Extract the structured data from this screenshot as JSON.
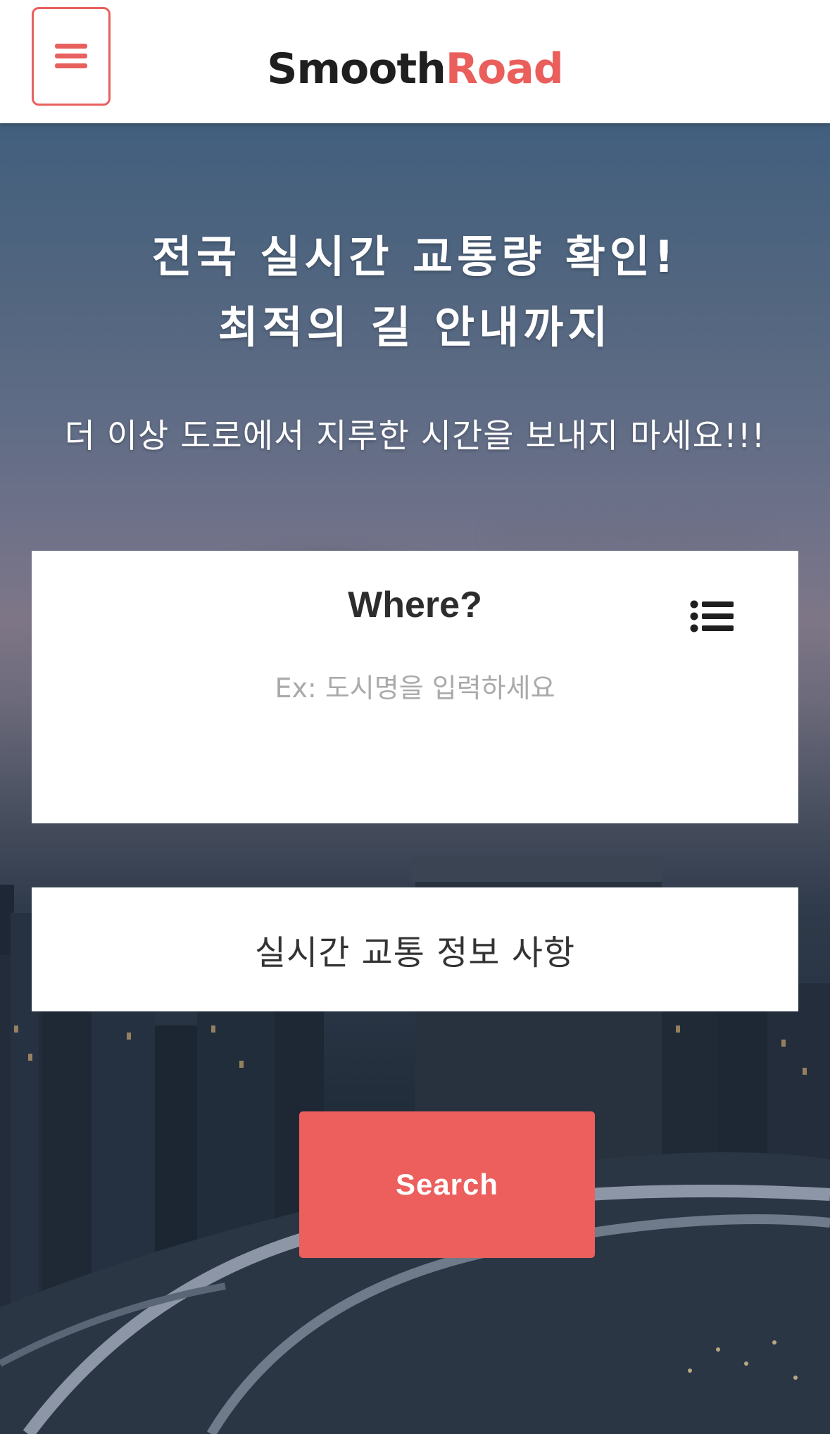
{
  "header": {
    "brand_part1": "Smooth",
    "brand_part2": "Road",
    "menu_icon": "hamburger-icon",
    "accent_color": "#ea5e5c"
  },
  "hero": {
    "headline_line1": "전국 실시간 교통량 확인!",
    "headline_line2": "최적의 길 안내까지",
    "subline": "더 이상 도로에서 지루한 시간을 보내지 마세요!!!"
  },
  "where_card": {
    "title": "Where?",
    "list_icon": "list-icon",
    "input_placeholder": "Ex: 도시명을 입력하세요",
    "input_value": ""
  },
  "info_card": {
    "label": "실시간 교통 정보 사항"
  },
  "search_button": {
    "label": "Search",
    "color": "#ec5f5d"
  }
}
